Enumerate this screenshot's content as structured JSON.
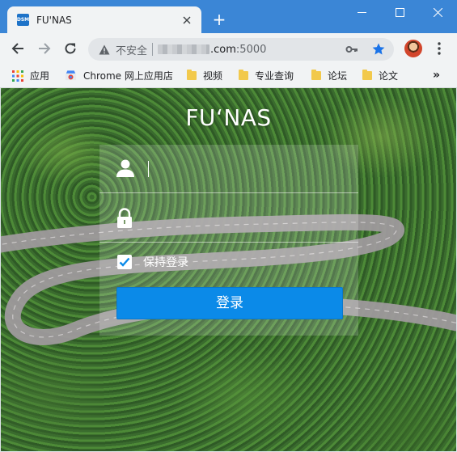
{
  "colors": {
    "tabstrip": "#3b86d6",
    "toolbar": "#f1f3f4",
    "login_button": "#0b8ae8",
    "star": "#1a73e8"
  },
  "browser": {
    "tab": {
      "favicon_text": "DSM",
      "title": "FU'NAS",
      "close_icon": "close-icon"
    },
    "new_tab_label": "+",
    "address": {
      "security_label": "不安全",
      "url_host_suffix": ".com",
      "url_port": ":5000"
    },
    "bookmarks": [
      {
        "label": "应用",
        "icon": "apps-grid-icon"
      },
      {
        "label": "Chrome 网上应用店",
        "icon": "chrome-webstore-icon"
      },
      {
        "label": "视频",
        "icon": "folder-icon"
      },
      {
        "label": "专业查询",
        "icon": "folder-icon"
      },
      {
        "label": "论坛",
        "icon": "folder-icon"
      },
      {
        "label": "论文",
        "icon": "folder-icon"
      }
    ],
    "bookmarks_more": "»"
  },
  "login": {
    "brand": "FU‘NAS",
    "username_value": "",
    "password_value": "",
    "remember_checked": true,
    "remember_label": "保持登录",
    "submit_label": "登录"
  }
}
